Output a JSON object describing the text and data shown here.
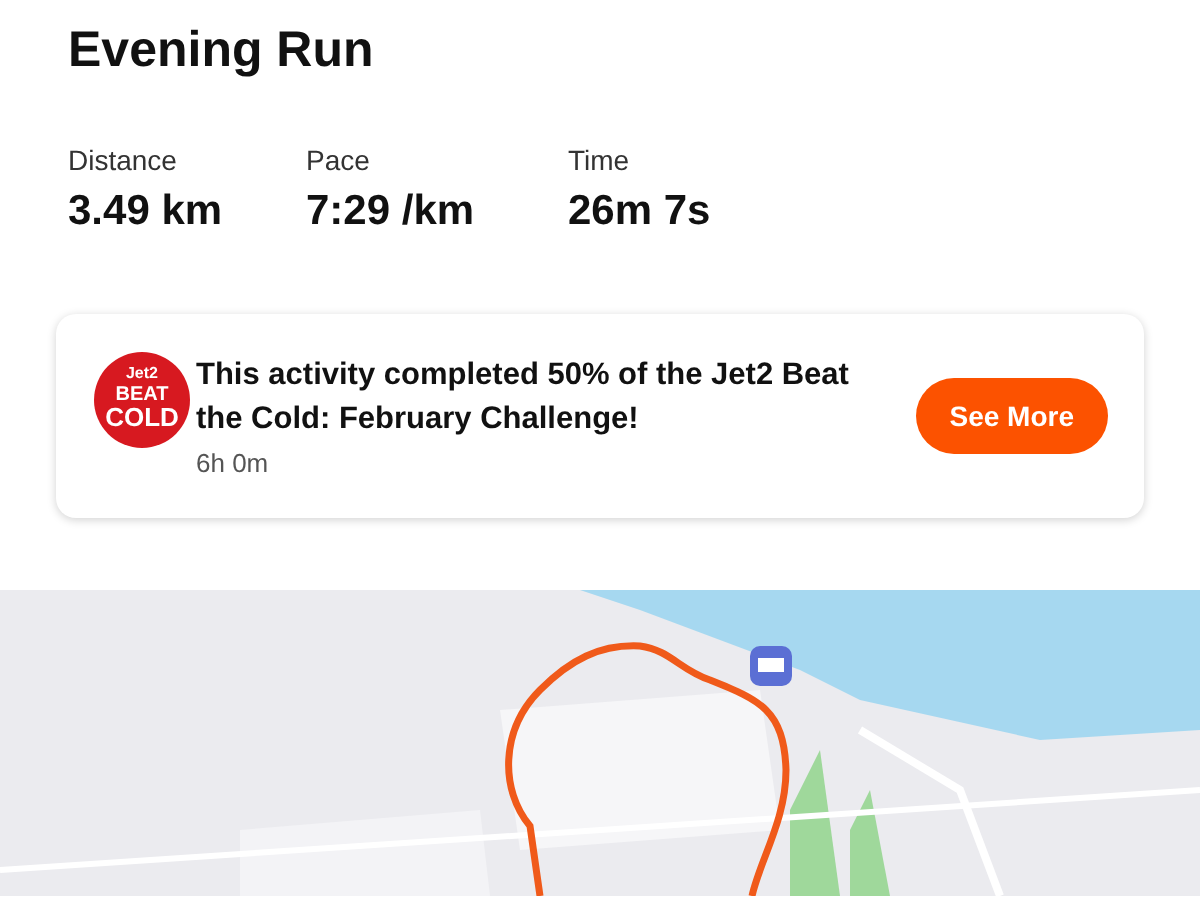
{
  "title": "Evening Run",
  "stats": [
    {
      "label": "Distance",
      "value": "3.49 km"
    },
    {
      "label": "Pace",
      "value": "7:29 /km"
    },
    {
      "label": "Time",
      "value": "26m 7s"
    }
  ],
  "challenge": {
    "badge_lines": [
      "Jet2",
      "BEAT",
      "COLD"
    ],
    "message": "This activity completed 50% of the Jet2 Beat the Cold: February Challenge!",
    "time": "6h 0m",
    "button": "See More"
  }
}
